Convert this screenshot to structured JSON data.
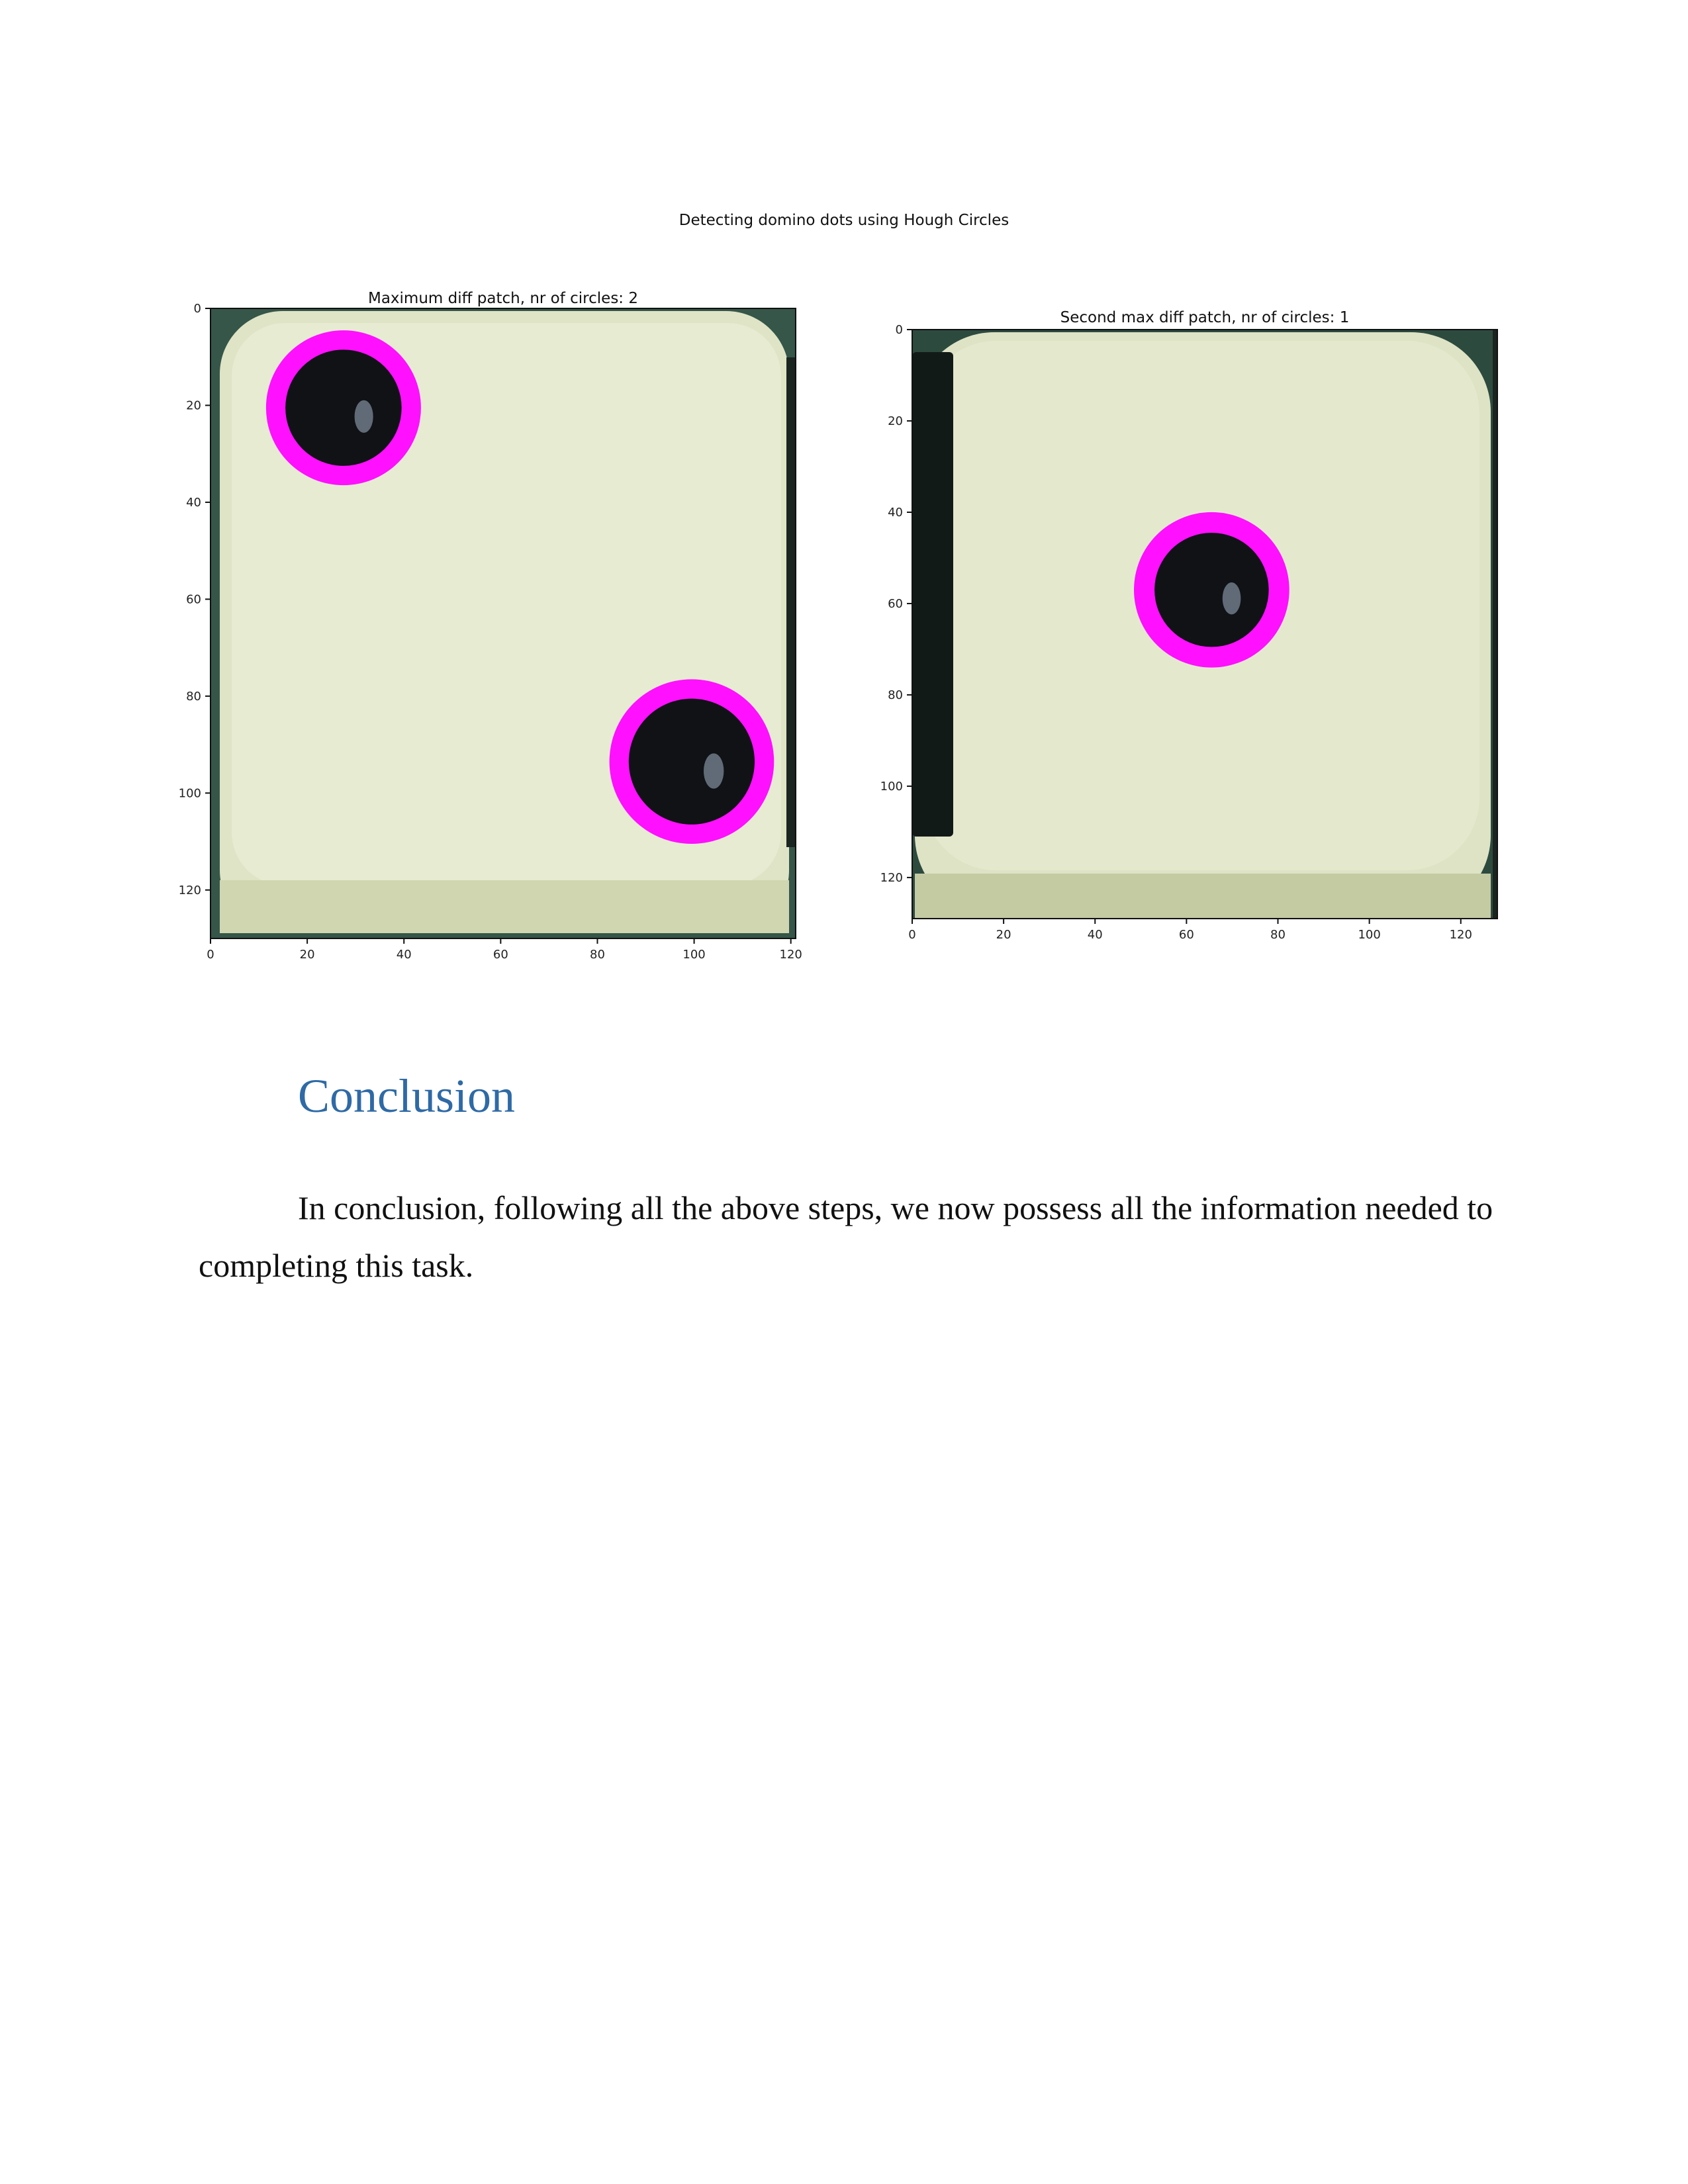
{
  "figure": {
    "suptitle": "Detecting domino dots using Hough Circles",
    "colors": {
      "tile": "#e3e8cc",
      "pip": "#101216",
      "circle": "#ff10ff",
      "background_edge": "#2d4a3f"
    },
    "panels": [
      {
        "title": "Maximum diff patch, nr of circles: 2",
        "image_extent": {
          "x": [
            0,
            121
          ],
          "y": [
            0,
            130
          ]
        },
        "xticks": [
          "0",
          "20",
          "40",
          "60",
          "80",
          "100",
          "120"
        ],
        "yticks": [
          "0",
          "20",
          "40",
          "60",
          "80",
          "100",
          "120"
        ],
        "xtick_values": [
          0,
          20,
          40,
          60,
          80,
          100,
          120
        ],
        "ytick_values": [
          0,
          20,
          40,
          60,
          80,
          100,
          120
        ],
        "circles": [
          {
            "cx": 27.5,
            "cy": 20.5,
            "r_inner": 12,
            "r_outer": 16
          },
          {
            "cx": 99.5,
            "cy": 93.5,
            "r_inner": 13,
            "r_outer": 17
          }
        ]
      },
      {
        "title": "Second max diff patch, nr of circles: 1",
        "image_extent": {
          "x": [
            0,
            128
          ],
          "y": [
            0,
            129
          ]
        },
        "xticks": [
          "0",
          "20",
          "40",
          "60",
          "80",
          "100",
          "120"
        ],
        "yticks": [
          "0",
          "20",
          "40",
          "60",
          "80",
          "100",
          "120"
        ],
        "xtick_values": [
          0,
          20,
          40,
          60,
          80,
          100,
          120
        ],
        "ytick_values": [
          0,
          20,
          40,
          60,
          80,
          100,
          120
        ],
        "circles": [
          {
            "cx": 65.5,
            "cy": 57.0,
            "r_inner": 12.5,
            "r_outer": 17
          }
        ]
      }
    ]
  },
  "section": {
    "heading": "Conclusion",
    "paragraph": "In conclusion, following all the above steps, we now possess all the information needed to completing this task."
  }
}
